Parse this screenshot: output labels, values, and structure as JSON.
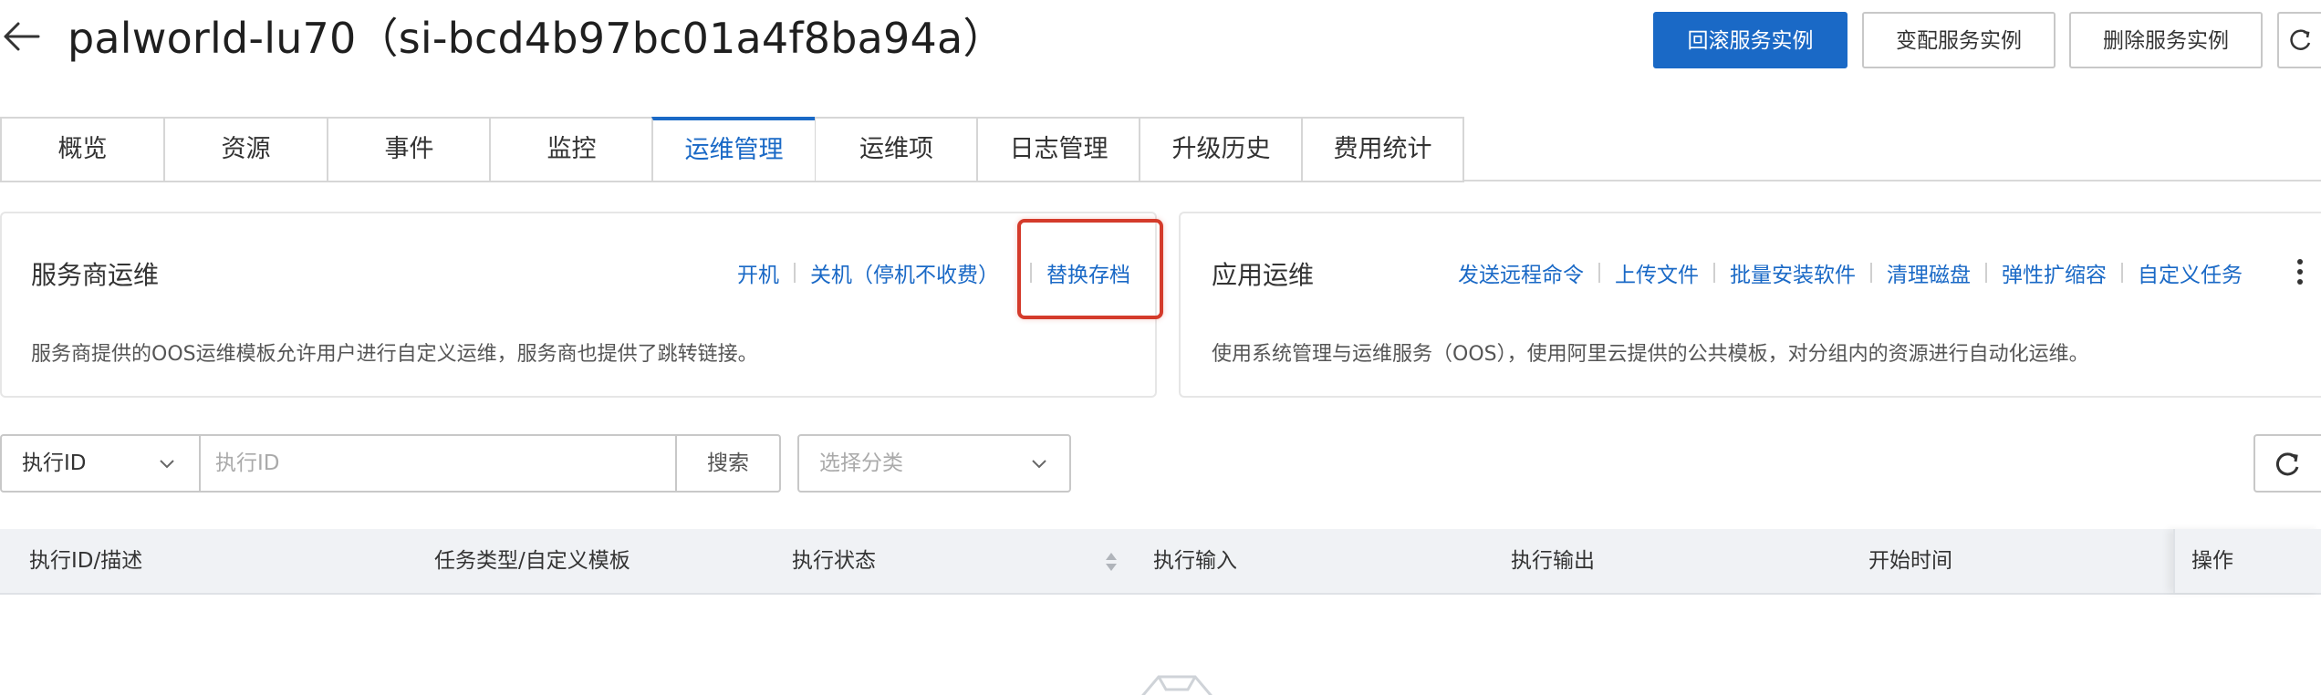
{
  "header": {
    "title": "palworld-lu70（si-bcd4b97bc01a4f8ba94a）",
    "actions": {
      "rollback": "回滚服务实例",
      "modify": "变配服务实例",
      "delete": "删除服务实例"
    },
    "icons": {
      "back": "arrow-left-icon",
      "refresh": "refresh-icon"
    }
  },
  "tabs": [
    {
      "label": "概览"
    },
    {
      "label": "资源"
    },
    {
      "label": "事件"
    },
    {
      "label": "监控"
    },
    {
      "label": "运维管理",
      "active": true
    },
    {
      "label": "运维项"
    },
    {
      "label": "日志管理"
    },
    {
      "label": "升级历史"
    },
    {
      "label": "费用统计"
    }
  ],
  "provider_panel": {
    "title": "服务商运维",
    "links": {
      "start": "开机",
      "stop": "关机（停机不收费）",
      "replace_save": "替换存档"
    },
    "description": "服务商提供的OOS运维模板允许用户进行自定义运维，服务商也提供了跳转链接。"
  },
  "app_panel": {
    "title": "应用运维",
    "links": {
      "remote_cmd": "发送远程命令",
      "upload": "上传文件",
      "batch_install": "批量安装软件",
      "clean_disk": "清理磁盘",
      "scaling": "弹性扩缩容",
      "custom_task": "自定义任务"
    },
    "description": "使用系统管理与运维服务（OOS），使用阿里云提供的公共模板，对分组内的资源进行自动化运维。"
  },
  "filter": {
    "field_select": "执行ID",
    "search_placeholder": "执行ID",
    "search_button": "搜索",
    "category_placeholder": "选择分类"
  },
  "table": {
    "columns": {
      "exec_id": "执行ID/描述",
      "task_type": "任务类型/自定义模板",
      "status": "执行状态",
      "input": "执行输入",
      "output": "执行输出",
      "start_time": "开始时间",
      "ops": "操作"
    },
    "rows": []
  },
  "colors": {
    "primary": "#1a69c6",
    "highlight": "#d43b2b",
    "table_header_bg": "#f0f2f5"
  }
}
